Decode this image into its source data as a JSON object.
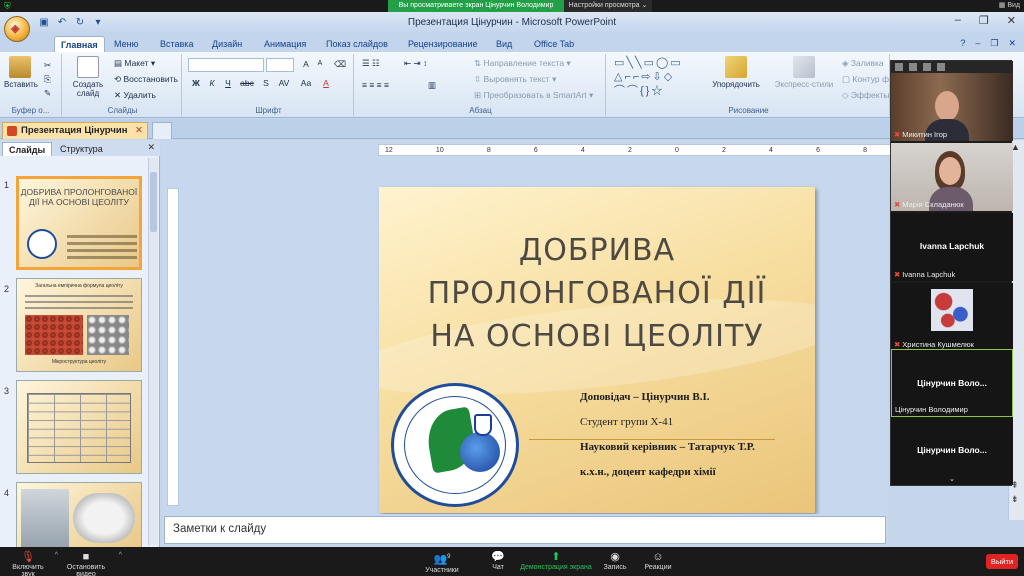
{
  "zoom": {
    "share_banner": "Вы просматриваете экран Цінурчин Володимир",
    "view_options": "Настройки просмотра",
    "view_button": "Вид",
    "toolbar": [
      {
        "label": "Включить звук",
        "icon": "mic-off-icon"
      },
      {
        "label": "Остановить видео",
        "icon": "video-icon"
      },
      {
        "label": "Участники",
        "icon": "participants-icon",
        "count": "9"
      },
      {
        "label": "Чат",
        "icon": "chat-icon"
      },
      {
        "label": "Демонстрация экрана",
        "icon": "share-screen-icon"
      },
      {
        "label": "Запись",
        "icon": "record-icon"
      },
      {
        "label": "Реакции",
        "icon": "reactions-icon"
      }
    ],
    "end_button": "Выйти",
    "participants": [
      {
        "name": "Микитин Ігор",
        "type": "video"
      },
      {
        "name": "Марія Складанюк",
        "type": "video"
      },
      {
        "name": "Ivanna Lapchuk",
        "center": "Ivanna Lapchuk",
        "type": "name"
      },
      {
        "name": "Христина Кушмелюк",
        "type": "avatar"
      },
      {
        "name": "Цінурчин Володимир",
        "center": "Цінурчин Воло...",
        "type": "name",
        "active": true
      },
      {
        "name": "",
        "center": "Цінурчин Воло...",
        "type": "name"
      }
    ]
  },
  "ppt": {
    "window_title": "Презентация Цінурчин - Microsoft PowerPoint",
    "tabs": [
      "Главная",
      "Меню",
      "Вставка",
      "Дизайн",
      "Анимация",
      "Показ слайдов",
      "Рецензирование",
      "Вид",
      "Office Tab"
    ],
    "active_tab": "Главная",
    "ribbon": {
      "clipboard": {
        "paste": "Вставить",
        "label": "Буфер о..."
      },
      "slides": {
        "new_slide": "Создать слайд",
        "layout": "Макет",
        "reset": "Восстановить",
        "delete": "Удалить",
        "label": "Слайды"
      },
      "font": {
        "label": "Шрифт",
        "bold": "Ж",
        "italic": "К",
        "underline": "Ч",
        "strike": "abc",
        "shadow": "S",
        "spacing": "AV",
        "case": "Aa",
        "color": "A",
        "grow": "A",
        "shrink": "A"
      },
      "paragraph": {
        "text_direction": "Направление текста",
        "align_text": "Выровнять текст",
        "smartart": "Преобразовать в SmartArt",
        "label": "Абзац"
      },
      "drawing": {
        "arrange": "Упорядочить",
        "quick_styles": "Экспресс-стили",
        "fill": "Заливка",
        "outline": "Контур ф",
        "effects": "Эффекты",
        "label": "Рисование"
      }
    },
    "doc_tab": "Презентация Цінурчин",
    "panel_tabs": [
      "Слайды",
      "Структура"
    ],
    "thumbnails": [
      {
        "num": "1",
        "title": "ДОБРИВА ПРОЛОНГОВАНОЇ ДІЇ НА ОСНОВІ ЦЕОЛІТУ"
      },
      {
        "num": "2",
        "title": "Загальна емпірична формула цеоліту",
        "caption": "Мікроструктура цеоліту"
      },
      {
        "num": "3"
      },
      {
        "num": "4"
      }
    ],
    "ruler_ticks": [
      "12",
      "10",
      "8",
      "6",
      "4",
      "2",
      "0",
      "2",
      "4",
      "6",
      "8",
      "10",
      "12"
    ],
    "slide": {
      "title_lines": [
        "ДОБРИВА",
        "ПРОЛОНГОВАНОЇ ДІЇ",
        "НА ОСНОВІ ЦЕОЛІТУ"
      ],
      "speaker_label": "Доповідач –",
      "speaker": "Цінурчин В.І.",
      "student": "Студент групи Х-41",
      "advisor_label": "Науковий керівник –",
      "advisor": "Татарчук Т.Р.",
      "degree": "к.х.н., доцент кафедри хімії",
      "logo_text": "ПРИКАРПАТСЬКИЙ НАЦІОНАЛЬНИЙ УНІВЕРСИТЕТ ІМЕНІ ВАСИЛЯ СТЕФАНИКА · ФАКУЛЬТЕТ ПРИРОДНИЧИХ НАУК"
    },
    "notes_placeholder": "Заметки к слайду"
  }
}
